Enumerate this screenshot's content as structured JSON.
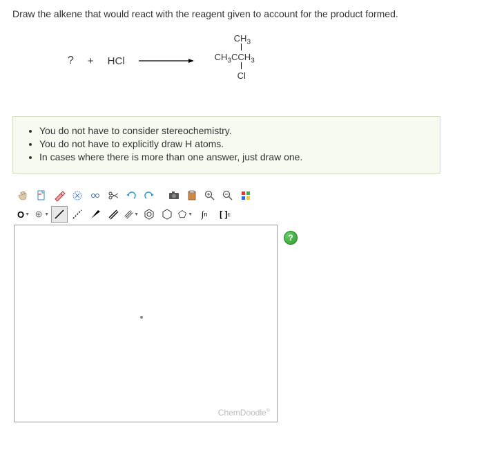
{
  "prompt": "Draw the alkene that would react with the reagent given to account for the product formed.",
  "reaction": {
    "unknown": "?",
    "plus": "+",
    "reagent": "HCl",
    "product": {
      "ch3_top": "CH",
      "ch3_top_sub": "3",
      "main": "CH",
      "main_sub1": "3",
      "main_c": "CCH",
      "main_sub2": "3",
      "cl": "Cl"
    }
  },
  "instructions": [
    "You do not have to consider stereochemistry.",
    "You do not have to explicitly draw H atoms.",
    "In cases where there is more than one answer, just draw one."
  ],
  "toolbar1": {
    "hand": "hand",
    "doc": "doc",
    "eraser": "eraser",
    "clear": "clear",
    "undo_chain": "undo-chain",
    "undo": "undo",
    "redo": "redo",
    "camera": "camera",
    "paste": "paste",
    "zoom_in": "zoom-in",
    "zoom_out": "zoom-out",
    "color": "color"
  },
  "toolbar2": {
    "element_o": "O",
    "charge": "charge",
    "single": "single",
    "dashed": "dashed",
    "wedge": "wedge",
    "double": "double",
    "triple": "triple",
    "benzene": "benzene",
    "cyclohexane": "cyclohexane",
    "cyclopentane": "cyclopentane",
    "fn": "n",
    "brackets": "[ ]",
    "plusminus": "±"
  },
  "help": "?",
  "branding": "ChemDoodle",
  "branding_tm": "®"
}
